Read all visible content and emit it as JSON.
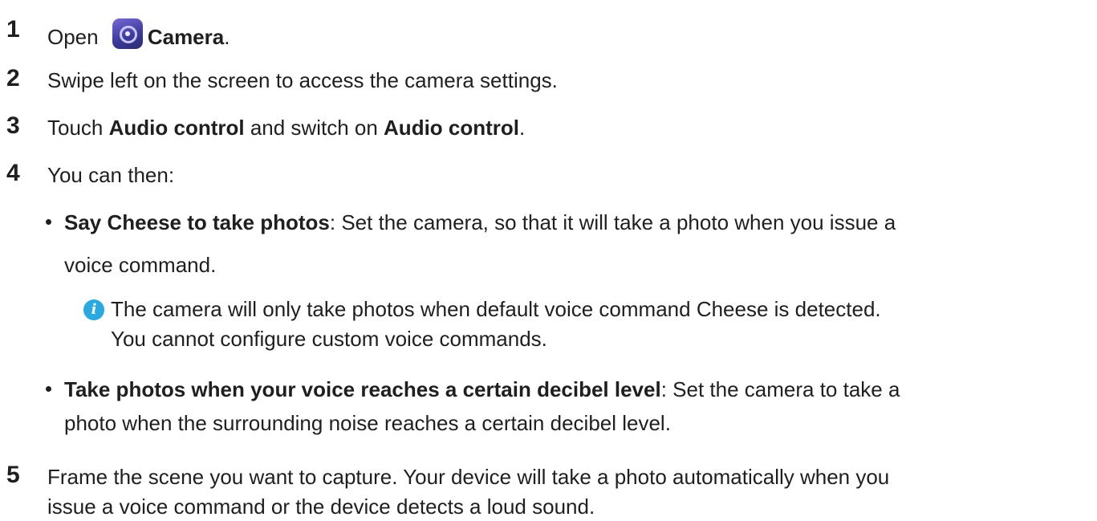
{
  "steps": [
    {
      "num": "1",
      "prefix": "Open ",
      "bold": "Camera",
      "suffix": "."
    },
    {
      "num": "2",
      "text": "Swipe left on the screen to access the camera settings."
    },
    {
      "num": "3",
      "t1": "Touch ",
      "b1": "Audio control",
      "t2": " and switch on ",
      "b2": "Audio control",
      "t3": "."
    },
    {
      "num": "4",
      "text": "You can then:"
    },
    {
      "num": "5",
      "line1": "Frame the scene you want to capture. Your device will take a photo automatically when you",
      "line2": "issue a voice command or the device detects a loud sound."
    }
  ],
  "bullets": [
    {
      "bold": "Say Cheese to take photos",
      "line1_rest": ": Set the camera, so that it will take a photo when you issue a",
      "line2": "voice command."
    },
    {
      "bold": "Take photos when your voice reaches a certain decibel level",
      "line1_rest": ": Set the camera to take a",
      "line2": "photo when the surrounding noise reaches a certain decibel level."
    }
  ],
  "note": {
    "icon": "info-icon",
    "line1": "The camera will only take photos when default voice command Cheese is detected.",
    "line2": "You cannot configure custom voice commands."
  },
  "icons": {
    "camera": "camera-app-icon"
  }
}
